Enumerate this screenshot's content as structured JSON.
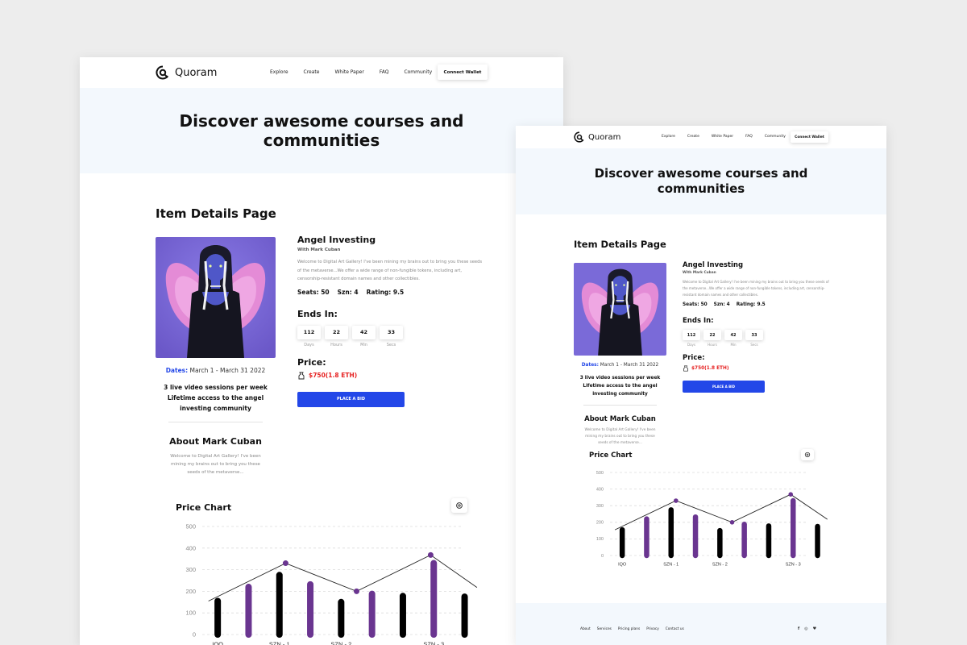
{
  "brand": {
    "name": "Quoram"
  },
  "nav": {
    "items": [
      "Explore",
      "Create",
      "White Paper",
      "FAQ",
      "Community"
    ],
    "cta": "Connect Wallet"
  },
  "hero": {
    "line1": "Discover awesome courses and",
    "line2": "communities"
  },
  "page_title": "Item Details Page",
  "item": {
    "title": "Angel Investing",
    "subtitle": "With Mark Cuban",
    "description": "Welcome to Digital Art Gallery! I've been mining my brains out to bring you these seeds of the metaverse...We offer a wide range of non-fungible tokens, including art, censorship-resistant domain names and other collectibles.",
    "stats": [
      "Seats: 50",
      "Szn: 4",
      "Rating: 9.5"
    ],
    "ends_label": "Ends In:",
    "countdown": [
      {
        "value": "112",
        "label": "Days"
      },
      {
        "value": "22",
        "label": "Hours"
      },
      {
        "value": "42",
        "label": "Min"
      },
      {
        "value": "33",
        "label": "Secs"
      }
    ],
    "price_label": "Price:",
    "price": "$750(1.8 ETH)",
    "bid_label": "PLACE A BID"
  },
  "details": {
    "dates_label": "Dates:",
    "dates_value": "March 1 - March 31 2022",
    "sessions": [
      "3 live video sessions per week",
      "Lifetime access to the angel",
      "investing community"
    ]
  },
  "about": {
    "title": "About Mark Cuban",
    "text_lines": [
      "Welcome to Digital Art Gallery! I've been",
      "mining my brains out to bring you these",
      "seeds of the metaverse..."
    ]
  },
  "chart_title": "Price Chart",
  "footer": {
    "links": [
      "About",
      "Services",
      "Pricing plans",
      "Privacy",
      "Contact us"
    ],
    "social": [
      "f",
      "◎",
      "♥"
    ]
  },
  "colors": {
    "accent": "#2347e8",
    "purple": "#6a3590",
    "hero_bg": "#f3f8fd",
    "price_red": "#e62222"
  },
  "chart_data": {
    "type": "bar",
    "title": "Price Chart",
    "ylim": [
      0,
      500
    ],
    "yticks": [
      0,
      100,
      200,
      300,
      400,
      500
    ],
    "grid": true,
    "bars": [
      {
        "value": 155,
        "color": "black"
      },
      {
        "value": 220,
        "color": "purple"
      },
      {
        "value": 275,
        "color": "black"
      },
      {
        "value": 232,
        "color": "purple"
      },
      {
        "value": 150,
        "color": "black"
      },
      {
        "value": 188,
        "color": "purple"
      },
      {
        "value": 178,
        "color": "black"
      },
      {
        "value": 330,
        "color": "purple"
      },
      {
        "value": 175,
        "color": "black"
      }
    ],
    "xtick_labels": [
      {
        "text": "IQO",
        "at": 0
      },
      {
        "text": "SZN - 1",
        "at": 2
      },
      {
        "text": "SZN - 2",
        "at": 4
      },
      {
        "text": "SZN - 3",
        "at": 7
      }
    ],
    "line": [
      {
        "x": -0.3,
        "y": 155
      },
      {
        "x": 2.2,
        "y": 330
      },
      {
        "x": 4.5,
        "y": 200
      },
      {
        "x": 6.9,
        "y": 368
      },
      {
        "x": 8.4,
        "y": 218
      }
    ],
    "markers": [
      1,
      2,
      3
    ]
  }
}
